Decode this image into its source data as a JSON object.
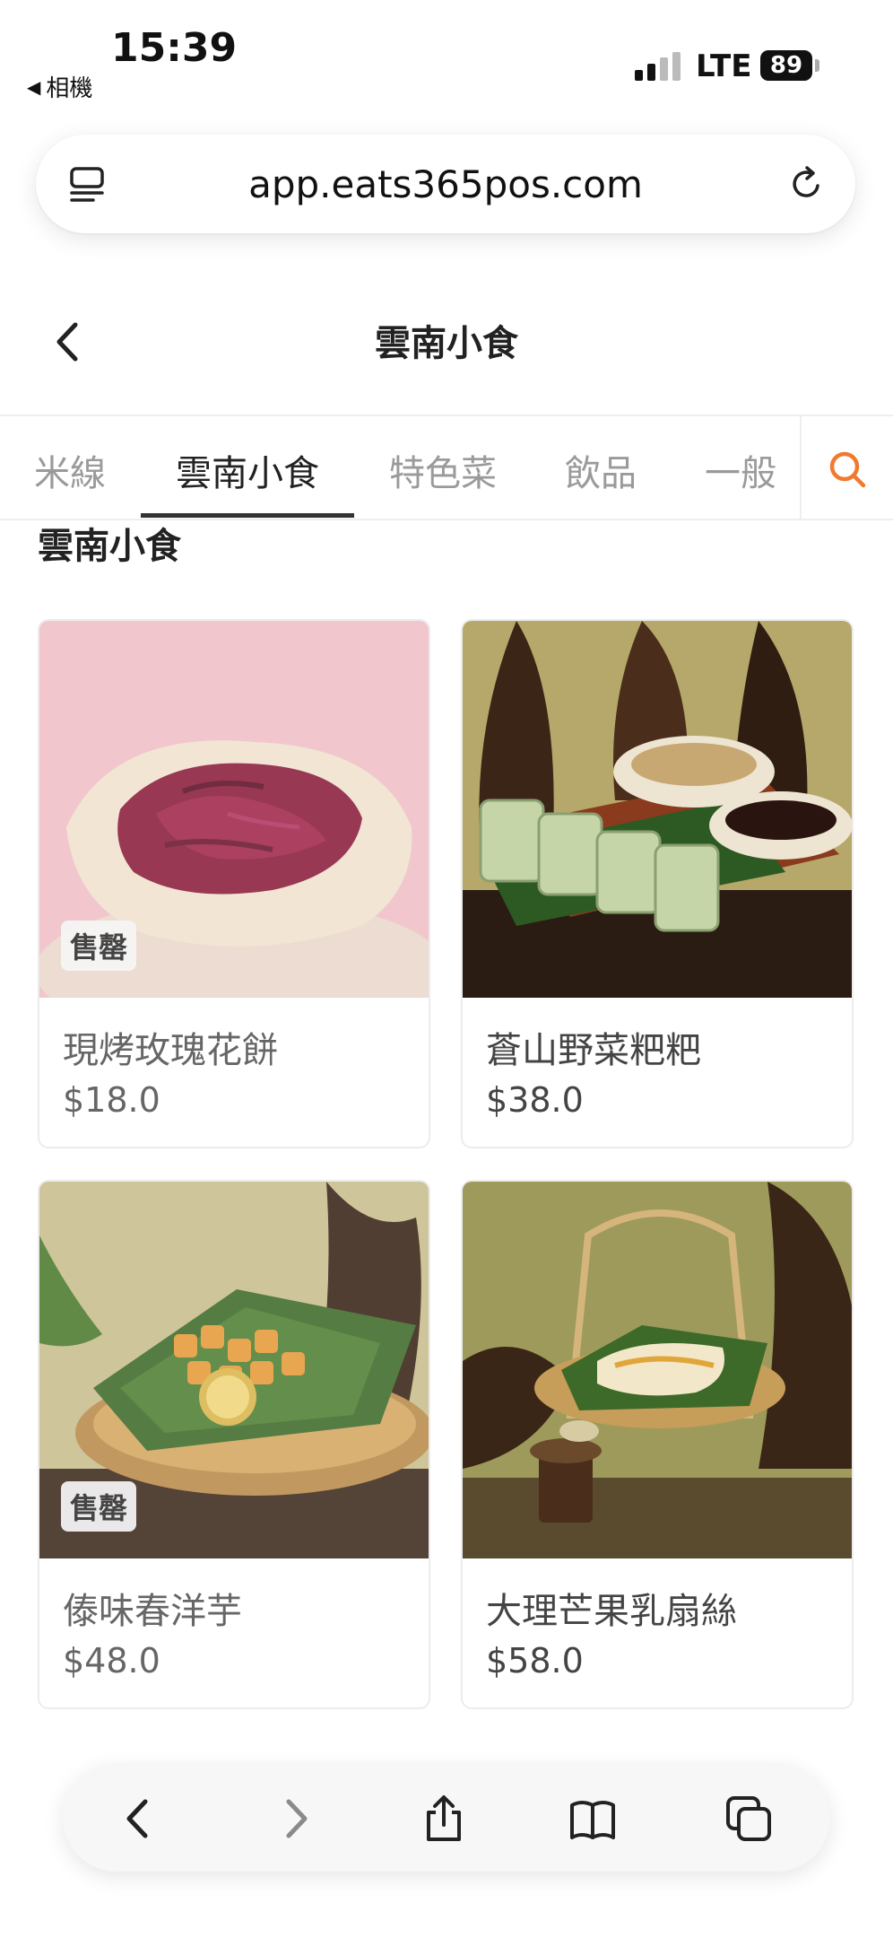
{
  "status_bar": {
    "time": "15:39",
    "back_app": "相機",
    "network": "LTE",
    "battery": "89"
  },
  "browser": {
    "url": "app.eats365pos.com",
    "icons": [
      "reader-icon",
      "reload-icon"
    ]
  },
  "header": {
    "title": "雲南小食"
  },
  "tabs": [
    {
      "label": "米線",
      "active": false
    },
    {
      "label": "雲南小食",
      "active": true
    },
    {
      "label": "特色菜",
      "active": false
    },
    {
      "label": "飲品",
      "active": false
    },
    {
      "label": "一般",
      "active": false
    }
  ],
  "section": {
    "title": "雲南小食"
  },
  "products": [
    {
      "name": "現烤玫瑰花餅",
      "price": "$18.0",
      "badge": "售罄",
      "sold_out": true
    },
    {
      "name": "蒼山野菜粑粑",
      "price": "$38.0",
      "badge": "",
      "sold_out": false
    },
    {
      "name": "傣味春洋芋",
      "price": "$48.0",
      "badge": "售罄",
      "sold_out": true
    },
    {
      "name": "大理芒果乳扇絲",
      "price": "$58.0",
      "badge": "",
      "sold_out": false
    }
  ],
  "colors": {
    "accent": "#f07b2f",
    "tab_active": "#222222",
    "tab_inactive": "#9a9a9a"
  },
  "toolbar": {
    "icons": [
      "back-icon",
      "forward-icon",
      "share-icon",
      "bookmarks-icon",
      "tabs-icon"
    ]
  }
}
